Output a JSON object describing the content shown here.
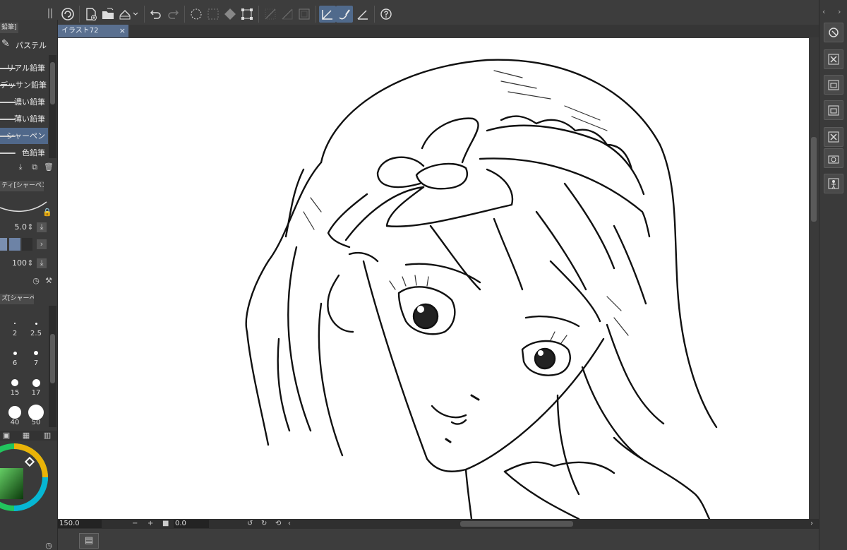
{
  "document": {
    "tab_title": "イラスト72",
    "close_glyph": "×"
  },
  "left_panel": {
    "group_tab": "鉛筆]",
    "category": "パステル",
    "brushes": [
      {
        "label": "リアル鉛筆",
        "selected": false
      },
      {
        "label": "デッサン鉛筆",
        "selected": false
      },
      {
        "label": "濃い鉛筆",
        "selected": false
      },
      {
        "label": "薄い鉛筆",
        "selected": false
      },
      {
        "label": "シャーペン",
        "selected": true
      },
      {
        "label": "色鉛筆",
        "selected": false
      }
    ],
    "tool_property_tab": "ティ[シャーペン]",
    "brush_size_value": "5.0",
    "opacity_value": "100",
    "brush_size_tab": "ズ[シャーペン]",
    "size_presets": [
      "2",
      "2.5",
      "6",
      "7",
      "15",
      "17",
      "40",
      "50"
    ]
  },
  "status_bar": {
    "zoom": "150.0",
    "angle": "0.0",
    "minus": "−",
    "plus": "+"
  },
  "colors": {
    "accent": "#50688a",
    "tab_active": "#5a7090",
    "panel_bg": "#3a3a3a",
    "color_ring": "#22c55e"
  },
  "icons": {
    "toolbar": [
      "clip-studio-icon",
      "new-file-icon",
      "open-folder-icon",
      "save-icon",
      "undo-icon",
      "redo-icon",
      "select-all-icon",
      "deselect-icon",
      "fill-selection-icon",
      "transform-icon",
      "snap-off-icon",
      "snap-ruler-icon",
      "snap-grid-icon",
      "pen-snap-icon",
      "pencil-stroke-icon",
      "ruler-icon",
      "help-icon"
    ],
    "right": [
      "navigator-icon",
      "close-panel-icon",
      "material-icon",
      "material-icon-2",
      "close-panel-icon-2",
      "camera-icon",
      "person-icon"
    ]
  }
}
